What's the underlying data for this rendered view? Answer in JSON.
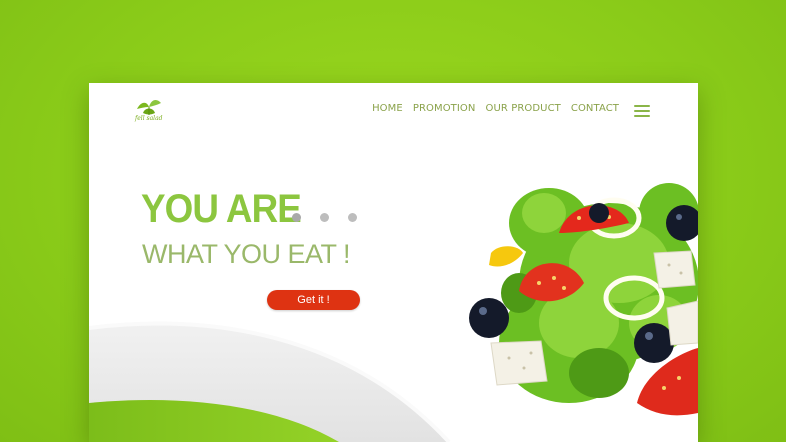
{
  "brand": {
    "logo_text": "fell salad",
    "logo_icon": "leaf-logo-icon"
  },
  "nav": {
    "items": [
      "HOME",
      "PROMOTION",
      "OUR PRODUCT",
      "CONTACT"
    ],
    "menu_icon": "hamburger-menu-icon"
  },
  "hero": {
    "headline": "YOU ARE",
    "subheadline": "WHAT YOU EAT !",
    "cta_label": "Get it !",
    "dots_count": 3
  },
  "colors": {
    "page_background": "#8ccf1a",
    "headline": "#8cc63f",
    "subheadline": "#9ab86a",
    "nav_text": "#8aa24a",
    "cta_background": "#de3312",
    "accent_green": "#7cb81f"
  }
}
